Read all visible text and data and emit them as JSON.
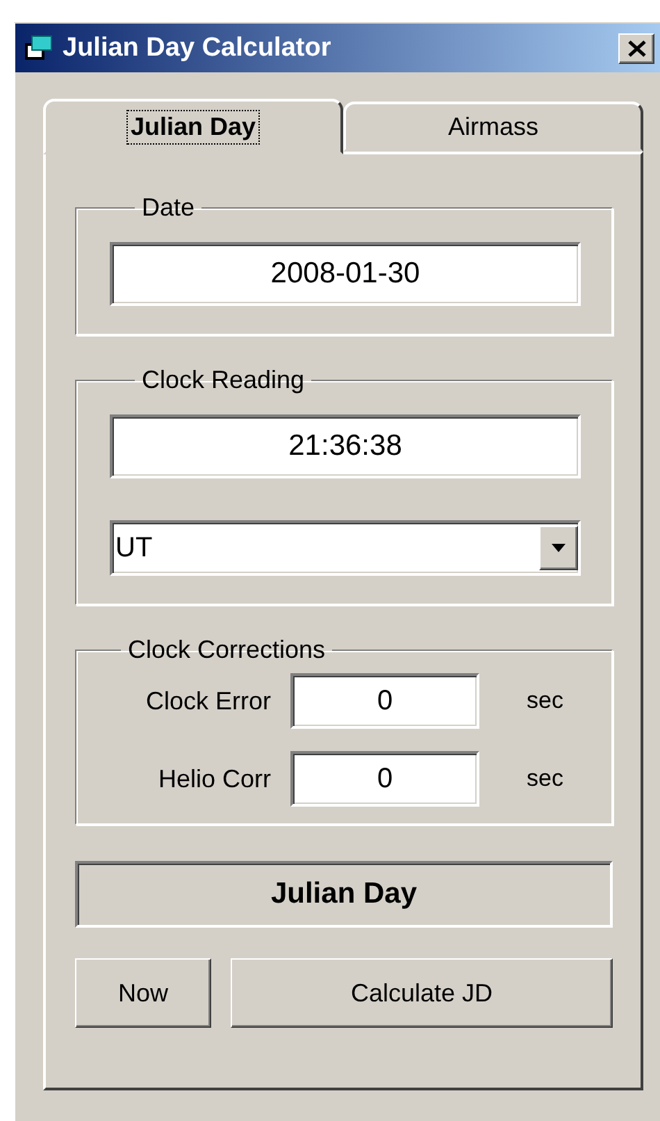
{
  "window": {
    "title": "Julian Day Calculator"
  },
  "tabs": [
    {
      "label": "Julian Day",
      "selected": true
    },
    {
      "label": "Airmass",
      "selected": false
    }
  ],
  "groups": [
    {
      "title": "Date",
      "rows": [
        {
          "kind": "field",
          "value": "2008-01-30"
        }
      ]
    },
    {
      "title": "Clock Reading",
      "rows": [
        {
          "kind": "field",
          "value": "21:36:38"
        },
        {
          "kind": "select",
          "value": "UT"
        }
      ]
    },
    {
      "title": "Clock Corrections",
      "rows": [
        {
          "kind": "labeled",
          "label": "Clock Error",
          "value": "0",
          "unit": "sec"
        },
        {
          "kind": "labeled",
          "label": "Helio Corr",
          "value": "0",
          "unit": "sec"
        }
      ]
    }
  ],
  "result": {
    "label": "Julian Day"
  },
  "buttons": [
    {
      "label": "Now"
    },
    {
      "label": "Calculate JD"
    }
  ]
}
